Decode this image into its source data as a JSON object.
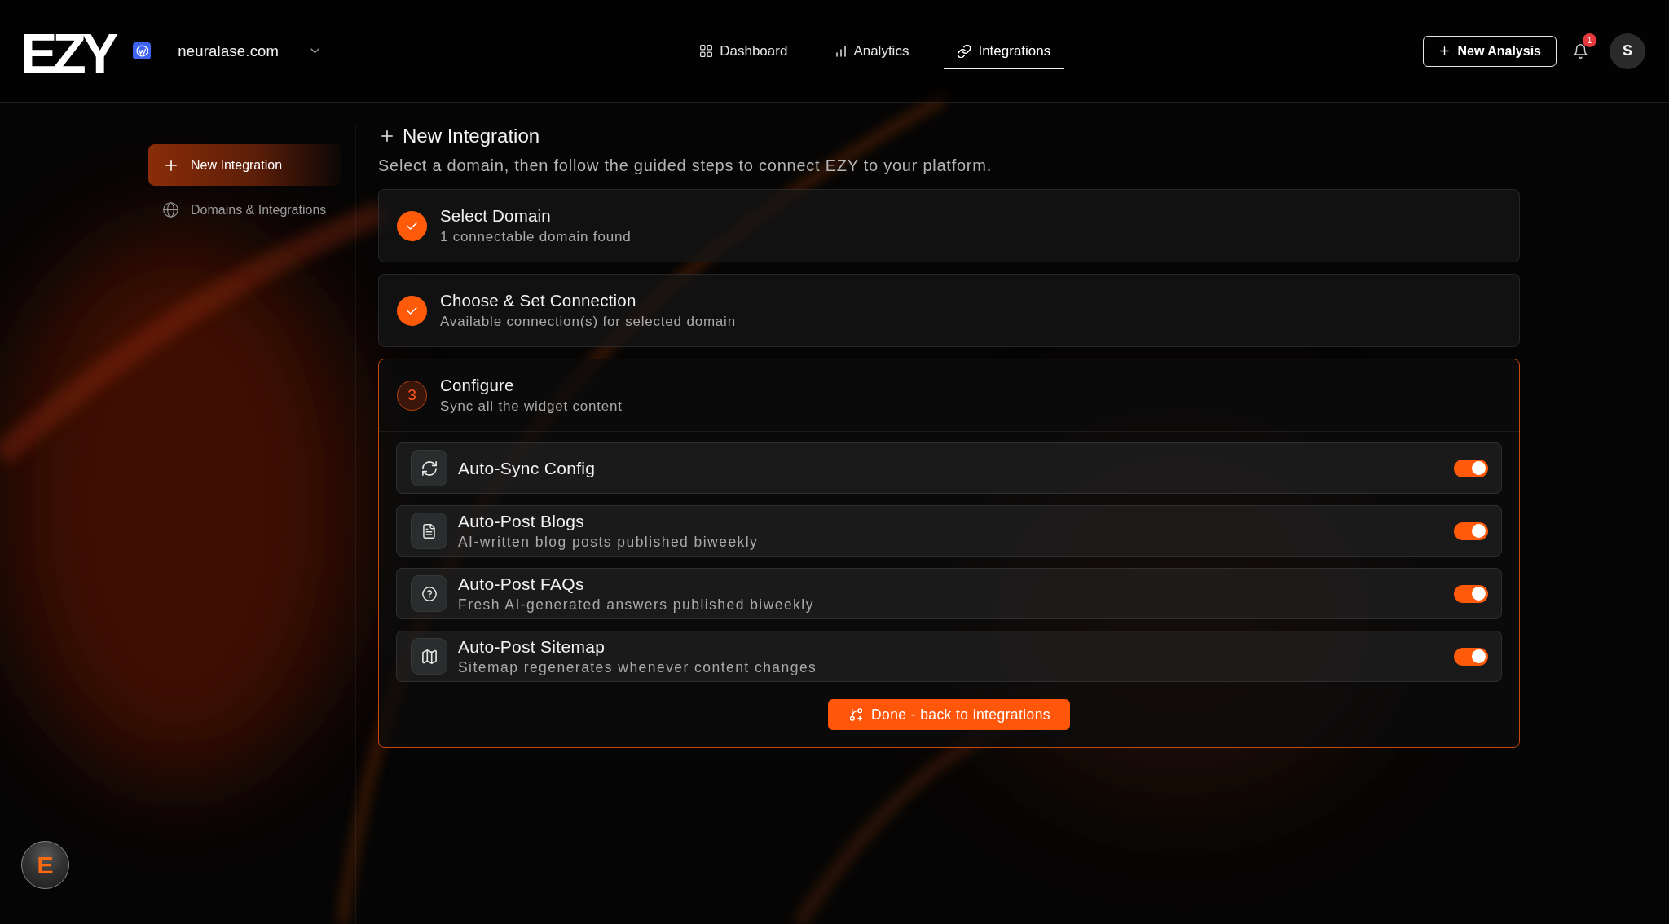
{
  "header": {
    "logo": "EZY",
    "domain": "neuralase.com",
    "nav": [
      {
        "label": "Dashboard",
        "selected": false
      },
      {
        "label": "Analytics",
        "selected": false
      },
      {
        "label": "Integrations",
        "selected": true
      }
    ],
    "new_analysis_button": {
      "label": "New Analysis"
    },
    "notifications": {
      "count": "1"
    },
    "avatar": {
      "initial": "S"
    }
  },
  "sidebar": {
    "items": [
      {
        "label": "New Integration",
        "selected": true
      },
      {
        "label": "Domains & Integrations",
        "selected": false
      }
    ]
  },
  "page": {
    "title": "New Integration",
    "subtitle": "Select a domain, then follow the guided steps to connect EZY to your platform."
  },
  "steps": [
    {
      "title": "Select Domain",
      "subtitle": "1 connectable domain found",
      "completed": true,
      "active": false
    },
    {
      "title": "Choose & Set Connection",
      "subtitle": "Available connection(s) for selected domain",
      "completed": true,
      "active": false
    },
    {
      "number": "3",
      "title": "Configure",
      "subtitle": "Sync all the widget content",
      "completed": false,
      "active": true,
      "options": [
        {
          "title": "Auto-Sync Config",
          "on": true
        },
        {
          "title": "Auto-Post Blogs",
          "description": "AI-written blog posts published biweekly",
          "on": true
        },
        {
          "title": "Auto-Post FAQs",
          "description": "Fresh AI-generated answers published biweekly",
          "on": true
        },
        {
          "title": "Auto-Post Sitemap",
          "description": "Sitemap regenerates whenever content changes",
          "on": true
        }
      ],
      "action_button": {
        "label": "Done - back to integrations"
      }
    }
  ],
  "assistant_launcher": {
    "logo": "E"
  }
}
